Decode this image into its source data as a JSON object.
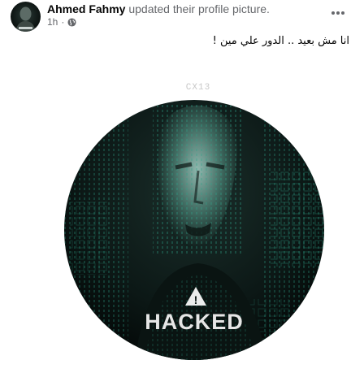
{
  "post": {
    "author_name": "Ahmed Fahmy",
    "action_text": "updated their profile picture.",
    "time": "1h",
    "dot": "·",
    "privacy_icon": "globe-icon",
    "more_icon": "more-horizontal-icon",
    "text": "انا مش بعيد .. الدور علي مين !"
  },
  "picture": {
    "badge": "CX13",
    "warning_symbol": "!",
    "label": "HACKED",
    "colors": {
      "background": "#0c1816",
      "accent": "#2fa38a",
      "label": "#e6e6e6"
    }
  }
}
